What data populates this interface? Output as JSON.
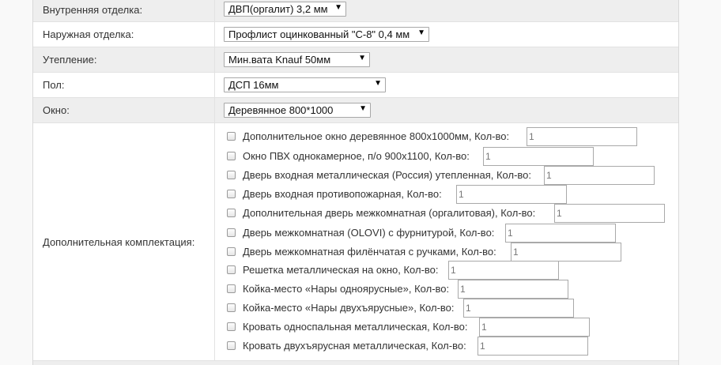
{
  "rows": [
    {
      "label": "Внутренняя отделка:",
      "value": "ДВП(оргалит) 3,2 мм"
    },
    {
      "label": "Наружная отделка:",
      "value": "Профлист оцинкованный \"С-8\" 0,4 мм"
    },
    {
      "label": "Утепление:",
      "value": "Мин.вата Knauf 50мм"
    },
    {
      "label": "Пол:",
      "value": "ДСП 16мм"
    },
    {
      "label": "Окно:",
      "value": "Деревянное 800*1000"
    }
  ],
  "extras": {
    "label": "Дополнительная комплектация:",
    "qty_label": "Кол-во:",
    "items": [
      {
        "label": "Дополнительное окно деревянное 800х1000мм,",
        "qty": "1"
      },
      {
        "label": "Окно ПВХ однокамерное, п/о 900х1100,",
        "qty": "1"
      },
      {
        "label": "Дверь входная металлическая (Россия) утепленная,",
        "qty": "1"
      },
      {
        "label": "Дверь входная противопожарная,",
        "qty": "1"
      },
      {
        "label": "Дополнительная дверь межкомнатная (оргалитовая),",
        "qty": "1"
      },
      {
        "label": "Дверь межкомнатная (OLOVI) с фурнитурой,",
        "qty": "1"
      },
      {
        "label": "Дверь межкомнатная филёнчатая с ручками,",
        "qty": "1"
      },
      {
        "label": "Решетка металлическая на окно,",
        "qty": "1"
      },
      {
        "label": "Койка-место «Нары одноярусные»,",
        "qty": "1"
      },
      {
        "label": "Койка-место «Нары двухъярусные»,",
        "qty": "1"
      },
      {
        "label": "Кровать односпальная металлическая,",
        "qty": "1"
      },
      {
        "label": "Кровать двухъярусная металлическая,",
        "qty": "1"
      }
    ]
  },
  "icons": {
    "dropdown": "caret-down-icon",
    "checkbox": "checkbox-icon"
  }
}
